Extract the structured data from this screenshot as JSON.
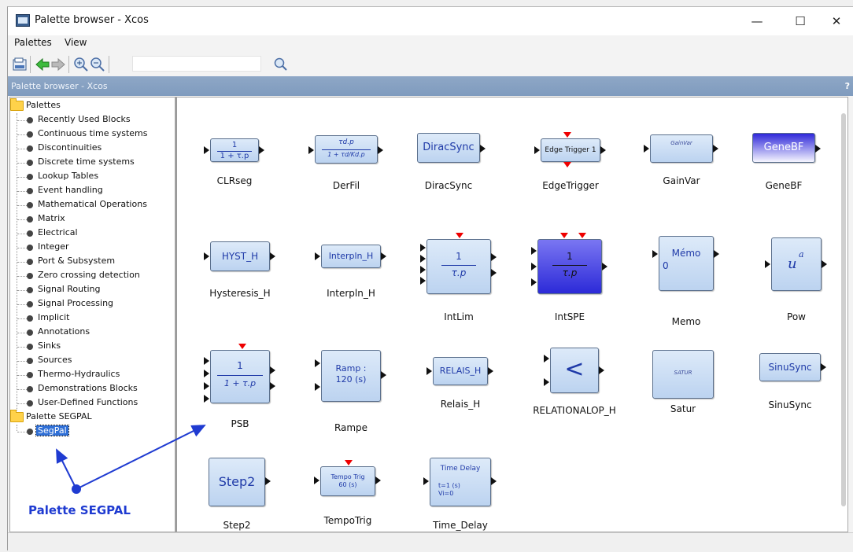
{
  "window": {
    "title": "Palette browser - Xcos",
    "controls": {
      "minimize": "—",
      "maximize": "☐",
      "close": "✕"
    }
  },
  "menubar": [
    "Palettes",
    "View"
  ],
  "toolbar": {
    "search_value": ""
  },
  "panel_header": {
    "title": "Palette browser - Xcos",
    "help": "?"
  },
  "tree": {
    "root1": "Palettes",
    "items": [
      "Recently Used Blocks",
      "Continuous time systems",
      "Discontinuities",
      "Discrete time systems",
      "Lookup Tables",
      "Event handling",
      "Mathematical Operations",
      "Matrix",
      "Electrical",
      "Integer",
      "Port & Subsystem",
      "Zero crossing detection",
      "Signal Routing",
      "Signal Processing",
      "Implicit",
      "Annotations",
      "Sinks",
      "Sources",
      "Thermo-Hydraulics",
      "Demonstrations Blocks",
      "User-Defined Functions"
    ],
    "root2": "Palette SEGPAL",
    "selected_item": "SegPal"
  },
  "blocks": [
    {
      "name": "CLRseg",
      "text": "1",
      "text2": "1 + τ.p"
    },
    {
      "name": "DerFil",
      "text": "τd.p",
      "text2": "1 + τd/Kd.p"
    },
    {
      "name": "DiracSync",
      "text": "DiracSync"
    },
    {
      "name": "EdgeTrigger",
      "text": "Edge Trigger 1"
    },
    {
      "name": "GainVar",
      "text": "GainVar"
    },
    {
      "name": "GeneBF",
      "text": "GeneBF"
    },
    {
      "name": "Hysteresis_H",
      "text": "HYST_H"
    },
    {
      "name": "Interpln_H",
      "text": "Interpln_H"
    },
    {
      "name": "IntLim",
      "text": "1",
      "text2": "τ.p"
    },
    {
      "name": "IntSPE",
      "text": "1",
      "text2": "τ.p"
    },
    {
      "name": "Memo",
      "text": "Mémo",
      "text2": "0"
    },
    {
      "name": "Pow",
      "text": "u",
      "text2": "a"
    },
    {
      "name": "PSB",
      "text": "1",
      "text2": "1 + τ.p"
    },
    {
      "name": "Rampe",
      "text": "Ramp :",
      "text2": "120 (s)"
    },
    {
      "name": "Relais_H",
      "text": "RELAIS_H"
    },
    {
      "name": "RELATIONALOP_H",
      "text": "<"
    },
    {
      "name": "Satur",
      "text": "SATUR"
    },
    {
      "name": "SinuSync",
      "text": "SinuSync"
    },
    {
      "name": "Step2",
      "text": "Step2"
    },
    {
      "name": "TempoTrig",
      "text": "Tempo Trig",
      "text2": "60 (s)"
    },
    {
      "name": "Time_Delay",
      "text": "Time Delay",
      "text2": "t=1 (s)",
      "text3": "Vi=0"
    }
  ],
  "annotation": {
    "label": "Palette SEGPAL",
    "color": "#1f3bd1"
  }
}
